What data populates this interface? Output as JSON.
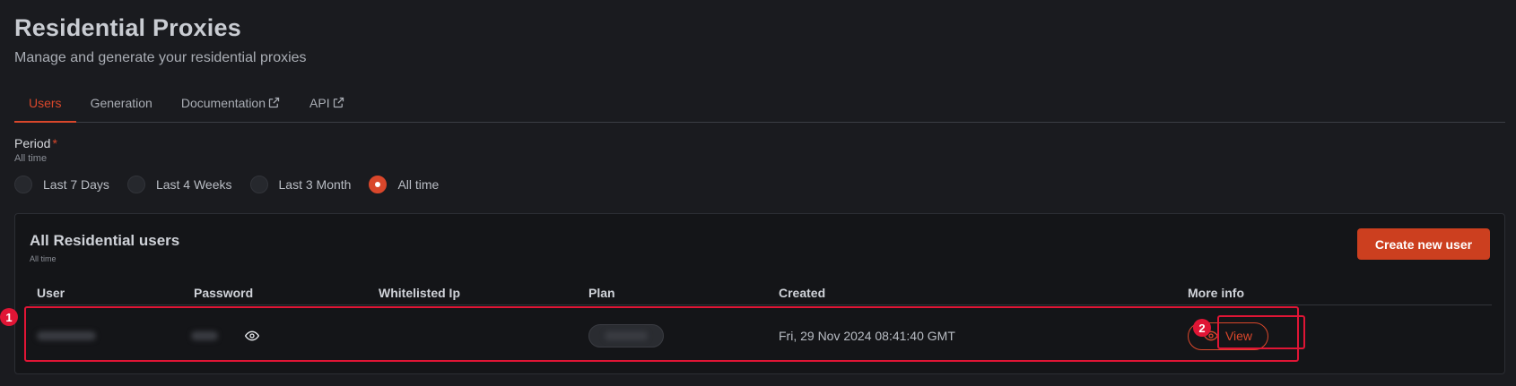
{
  "header": {
    "title": "Residential Proxies",
    "subtitle": "Manage and generate your residential proxies"
  },
  "tabs": [
    {
      "label": "Users",
      "active": true
    },
    {
      "label": "Generation",
      "active": false
    },
    {
      "label": "Documentation",
      "active": false,
      "icon": "external-link-icon"
    },
    {
      "label": "API",
      "active": false,
      "icon": "external-link-icon"
    }
  ],
  "period": {
    "label": "Period",
    "required_mark": "*",
    "hint": "All time",
    "options": [
      "Last 7 Days",
      "Last 4 Weeks",
      "Last 3 Month",
      "All time"
    ],
    "selected": "All time"
  },
  "users_card": {
    "title": "All Residential users",
    "subtitle": "All time",
    "create_button": "Create new user",
    "columns": [
      "User",
      "Password",
      "Whitelisted Ip",
      "Plan",
      "Created",
      "More info"
    ],
    "rows": [
      {
        "user": "",
        "password": "",
        "whitelisted_ip": "",
        "plan": "",
        "created": "Fri, 29 Nov 2024 08:41:40 GMT",
        "more_info": "View"
      }
    ]
  },
  "annotations": [
    "1",
    "2"
  ],
  "colors": {
    "accent": "#d9472b",
    "button_bg": "#cc3f1f",
    "background": "#1a1b1f",
    "card_bg": "#141518",
    "annotation": "#e01535"
  }
}
